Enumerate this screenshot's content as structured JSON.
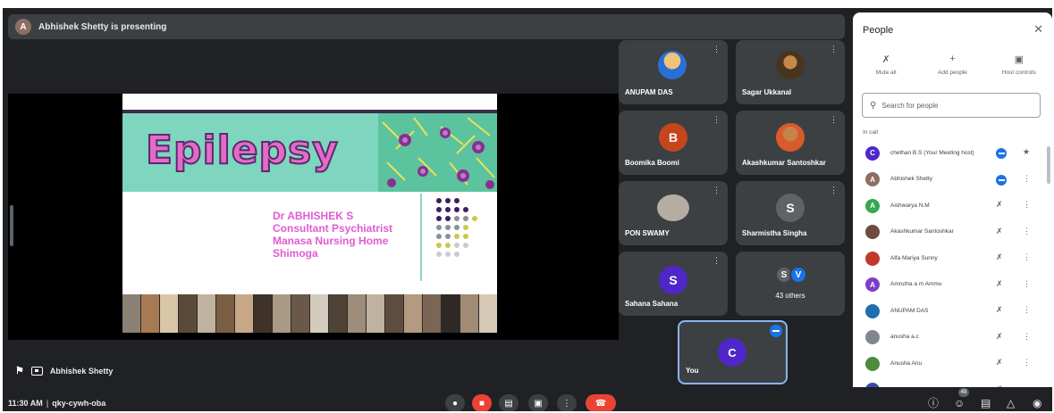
{
  "presenting": {
    "avatar_letter": "A",
    "text": "Abhishek Shetty is presenting"
  },
  "slide": {
    "title": "Epilepsy",
    "credits": [
      "Dr ABHISHEK S",
      "Consultant Psychiatrist",
      "Manasa Nursing Home",
      "Shimoga"
    ]
  },
  "presenter_label": "Abhishek Shetty",
  "tiles": [
    {
      "name": "ANUPAM DAS"
    },
    {
      "name": "Sagar Ukkanal"
    },
    {
      "name": "Boomika Boomi",
      "letter": "B",
      "color": "#c5461d"
    },
    {
      "name": "Akashkumar Santoshkar"
    },
    {
      "name": "PON SWAMY"
    },
    {
      "name": "Sharmistha Singha",
      "letter": "S",
      "color": "#5f6368"
    },
    {
      "name": "Sahana Sahana",
      "letter": "S",
      "color": "#4f27c9"
    }
  ],
  "others": {
    "letters": [
      "S",
      "V"
    ],
    "label": "43 others"
  },
  "self_tile": {
    "name": "You",
    "letter": "C",
    "color": "#4f27c9"
  },
  "bottom": {
    "time": "11:30 AM",
    "meeting_code": "qky-cywh-oba",
    "participant_badge": "49"
  },
  "people": {
    "title": "People",
    "actions": [
      {
        "label": "Mute all"
      },
      {
        "label": "Add people"
      },
      {
        "label": "Host controls"
      }
    ],
    "search_placeholder": "Search for people",
    "section": "In call",
    "participants": [
      {
        "name": "chethan B.S (Your Meeting host)",
        "letter": "C",
        "color": "#4f27c9",
        "status": "speaking"
      },
      {
        "name": "Abhishek Shetty",
        "letter": "A",
        "color": "#8d6e63",
        "status": "speaking"
      },
      {
        "name": "Aishwarya N.M",
        "letter": "A",
        "color": "#34a853",
        "status": "muted"
      },
      {
        "name": "Akashkumar Santoshkar",
        "letter": "",
        "color": "#6d4c41",
        "status": "muted"
      },
      {
        "name": "Alfa Mariya Sunny",
        "letter": "",
        "color": "#c0392b",
        "status": "muted"
      },
      {
        "name": "Amrutha a m Ammu",
        "letter": "A",
        "color": "#7b3fc4",
        "status": "muted"
      },
      {
        "name": "ANUPAM DAS",
        "letter": "",
        "color": "#1e6fb0",
        "status": "muted"
      },
      {
        "name": "anusha a.c",
        "letter": "",
        "color": "#80868b",
        "status": "muted"
      },
      {
        "name": "Anusha Anu",
        "letter": "",
        "color": "#4c8c3a",
        "status": "muted"
      },
      {
        "name": "",
        "letter": "",
        "color": "#3949ab",
        "status": "muted"
      }
    ]
  }
}
